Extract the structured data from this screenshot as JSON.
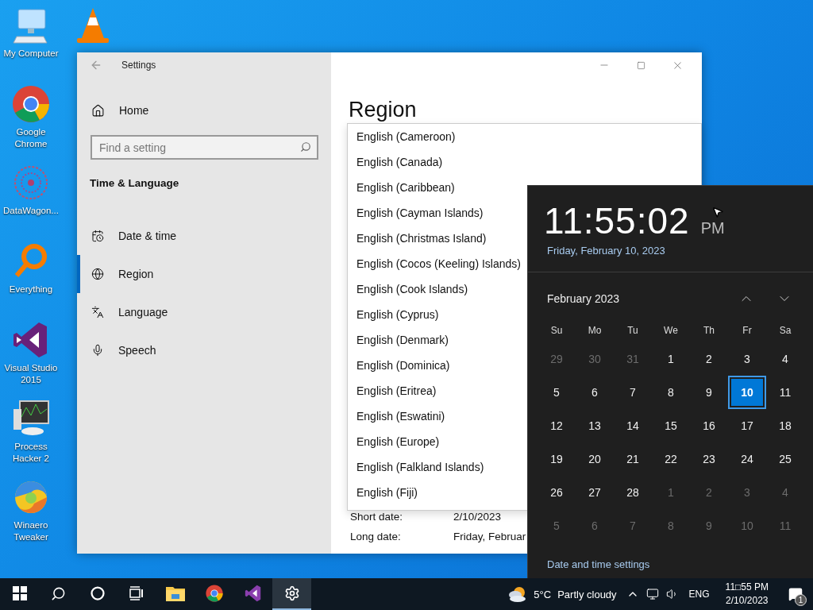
{
  "desktop_icons": [
    {
      "kind": "computer",
      "label": "My Computer"
    },
    {
      "kind": "chrome",
      "label": "Google Chrome"
    },
    {
      "kind": "datawagon",
      "label": "DataWagon..."
    },
    {
      "kind": "everything",
      "label": "Everything"
    },
    {
      "kind": "visualstudio",
      "label": "Visual Studio 2015"
    },
    {
      "kind": "processhacker",
      "label": "Process Hacker 2"
    },
    {
      "kind": "winaero",
      "label": "Winaero Tweaker"
    },
    {
      "kind": "vlc"
    }
  ],
  "settings": {
    "title": "Settings",
    "home": "Home",
    "search": {
      "placeholder": "Find a setting"
    },
    "section": "Time & Language",
    "nav": [
      {
        "kind": "datetime",
        "label": "Date & time",
        "selected": false
      },
      {
        "kind": "region",
        "label": "Region",
        "selected": true
      },
      {
        "kind": "language",
        "label": "Language",
        "selected": false
      },
      {
        "kind": "speech",
        "label": "Speech",
        "selected": false
      }
    ],
    "heading": "Region",
    "dropdown_options": [
      "English (Cameroon)",
      "English (Canada)",
      "English (Caribbean)",
      "English (Cayman Islands)",
      "English (Christmas Island)",
      "English (Cocos (Keeling) Islands)",
      "English (Cook Islands)",
      "English (Cyprus)",
      "English (Denmark)",
      "English (Dominica)",
      "English (Eritrea)",
      "English (Eswatini)",
      "English (Europe)",
      "English (Falkland Islands)",
      "English (Fiji)"
    ],
    "fields": [
      {
        "label": "Short date:",
        "value": "2/10/2023"
      },
      {
        "label": "Long date:",
        "value": "Friday, Februar"
      }
    ]
  },
  "clock_flyout": {
    "time": "11:55:02",
    "ampm": "PM",
    "date": "Friday, February 10, 2023",
    "month": "February 2023",
    "weekdays": [
      "Su",
      "Mo",
      "Tu",
      "We",
      "Th",
      "Fr",
      "Sa"
    ],
    "days": [
      {
        "label": "29",
        "in_month": false,
        "selected": false
      },
      {
        "label": "30",
        "in_month": false,
        "selected": false
      },
      {
        "label": "31",
        "in_month": false,
        "selected": false
      },
      {
        "label": "1",
        "in_month": true,
        "selected": false
      },
      {
        "label": "2",
        "in_month": true,
        "selected": false
      },
      {
        "label": "3",
        "in_month": true,
        "selected": false
      },
      {
        "label": "4",
        "in_month": true,
        "selected": false
      },
      {
        "label": "5",
        "in_month": true,
        "selected": false
      },
      {
        "label": "6",
        "in_month": true,
        "selected": false
      },
      {
        "label": "7",
        "in_month": true,
        "selected": false
      },
      {
        "label": "8",
        "in_month": true,
        "selected": false
      },
      {
        "label": "9",
        "in_month": true,
        "selected": false
      },
      {
        "label": "10",
        "in_month": true,
        "selected": true
      },
      {
        "label": "11",
        "in_month": true,
        "selected": false
      },
      {
        "label": "12",
        "in_month": true,
        "selected": false
      },
      {
        "label": "13",
        "in_month": true,
        "selected": false
      },
      {
        "label": "14",
        "in_month": true,
        "selected": false
      },
      {
        "label": "15",
        "in_month": true,
        "selected": false
      },
      {
        "label": "16",
        "in_month": true,
        "selected": false
      },
      {
        "label": "17",
        "in_month": true,
        "selected": false
      },
      {
        "label": "18",
        "in_month": true,
        "selected": false
      },
      {
        "label": "19",
        "in_month": true,
        "selected": false
      },
      {
        "label": "20",
        "in_month": true,
        "selected": false
      },
      {
        "label": "21",
        "in_month": true,
        "selected": false
      },
      {
        "label": "22",
        "in_month": true,
        "selected": false
      },
      {
        "label": "23",
        "in_month": true,
        "selected": false
      },
      {
        "label": "24",
        "in_month": true,
        "selected": false
      },
      {
        "label": "25",
        "in_month": true,
        "selected": false
      },
      {
        "label": "26",
        "in_month": true,
        "selected": false
      },
      {
        "label": "27",
        "in_month": true,
        "selected": false
      },
      {
        "label": "28",
        "in_month": true,
        "selected": false
      },
      {
        "label": "1",
        "in_month": false,
        "selected": false
      },
      {
        "label": "2",
        "in_month": false,
        "selected": false
      },
      {
        "label": "3",
        "in_month": false,
        "selected": false
      },
      {
        "label": "4",
        "in_month": false,
        "selected": false
      },
      {
        "label": "5",
        "in_month": false,
        "selected": false
      },
      {
        "label": "6",
        "in_month": false,
        "selected": false
      },
      {
        "label": "7",
        "in_month": false,
        "selected": false
      },
      {
        "label": "8",
        "in_month": false,
        "selected": false
      },
      {
        "label": "9",
        "in_month": false,
        "selected": false
      },
      {
        "label": "10",
        "in_month": false,
        "selected": false
      },
      {
        "label": "11",
        "in_month": false,
        "selected": false
      }
    ],
    "settings_link": "Date and time settings"
  },
  "taskbar": {
    "apps": [
      {
        "kind": "start",
        "active": false
      },
      {
        "kind": "search",
        "active": false
      },
      {
        "kind": "cortana",
        "active": false
      },
      {
        "kind": "taskview",
        "active": false
      },
      {
        "kind": "explorer",
        "active": false
      },
      {
        "kind": "chrome",
        "active": false
      },
      {
        "kind": "visualstudio",
        "active": false
      },
      {
        "kind": "settings",
        "active": true
      }
    ],
    "weather": {
      "temperature": "5°C",
      "condition": "Partly cloudy"
    },
    "language": "ENG",
    "time": "11□55 PM",
    "date": "2/10/2023",
    "notification_count": "1"
  }
}
